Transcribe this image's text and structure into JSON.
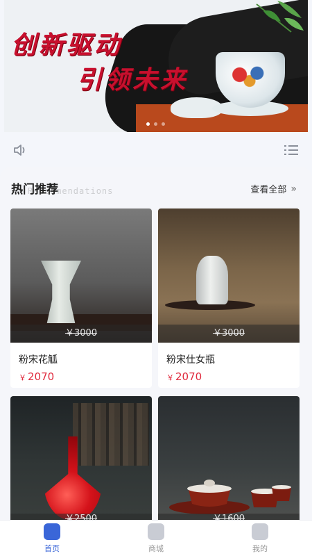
{
  "banner": {
    "line1": "创新驱动",
    "line2": "引领未来",
    "dots": 3,
    "active_dot": 1
  },
  "notice": {
    "speaker_icon": "speaker-icon",
    "menu_icon": "list-icon"
  },
  "section": {
    "title": "热门推荐",
    "subtitle": "Recommendations",
    "view_all": "查看全部",
    "view_all_icon": "double-chevron-right-icon"
  },
  "products": [
    {
      "name": "粉宋花觚",
      "original_price": "￥3000",
      "price": "2070",
      "currency": "￥"
    },
    {
      "name": "粉宋仕女瓶",
      "original_price": "￥3000",
      "price": "2070",
      "currency": "￥"
    },
    {
      "name": "",
      "original_price": "￥2500",
      "price": "",
      "currency": "￥"
    },
    {
      "name": "",
      "original_price": "￥1600",
      "price": "",
      "currency": "￥"
    }
  ],
  "tabbar": {
    "items": [
      {
        "label": "首页",
        "icon": "home-icon",
        "active": true
      },
      {
        "label": "商城",
        "icon": "shop-icon",
        "active": false
      },
      {
        "label": "我的",
        "icon": "profile-icon",
        "active": false
      }
    ]
  },
  "colors": {
    "accent": "#3a66d8",
    "price": "#e02a3d",
    "banner_text": "#c8102e"
  }
}
